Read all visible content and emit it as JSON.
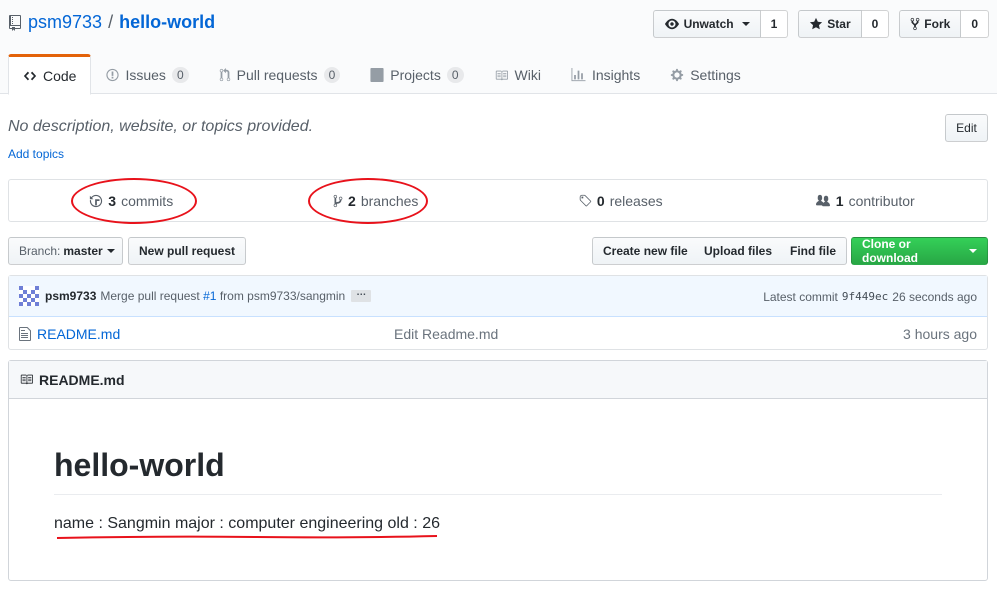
{
  "header": {
    "owner": "psm9733",
    "separator": "/",
    "repo": "hello-world",
    "actions": [
      {
        "label": "Unwatch",
        "count": "1",
        "icon": "eye-icon"
      },
      {
        "label": "Star",
        "count": "0",
        "icon": "star-icon"
      },
      {
        "label": "Fork",
        "count": "0",
        "icon": "fork-icon"
      }
    ]
  },
  "tabs": [
    {
      "label": "Code",
      "icon": "code-icon",
      "counter": null,
      "selected": true
    },
    {
      "label": "Issues",
      "icon": "issue-icon",
      "counter": "0"
    },
    {
      "label": "Pull requests",
      "icon": "pull-request-icon",
      "counter": "0"
    },
    {
      "label": "Projects",
      "icon": "project-icon",
      "counter": "0"
    },
    {
      "label": "Wiki",
      "icon": "book-icon",
      "counter": null
    },
    {
      "label": "Insights",
      "icon": "graph-icon",
      "counter": null
    },
    {
      "label": "Settings",
      "icon": "gear-icon",
      "counter": null
    }
  ],
  "description": {
    "text": "No description, website, or topics provided.",
    "add_topics": "Add topics",
    "edit": "Edit"
  },
  "summary": [
    {
      "count": "3",
      "label": "commits",
      "icon": "history-icon"
    },
    {
      "count": "2",
      "label": "branches",
      "icon": "branch-icon"
    },
    {
      "count": "0",
      "label": "releases",
      "icon": "tag-icon"
    },
    {
      "count": "1",
      "label": "contributor",
      "icon": "people-icon"
    }
  ],
  "filenav": {
    "branch_prefix": "Branch:",
    "branch": "master",
    "new_pr": "New pull request",
    "create_file": "Create new file",
    "upload_files": "Upload files",
    "find_file": "Find file",
    "clone": "Clone or download"
  },
  "commit": {
    "author": "psm9733",
    "message_prefix": "Merge pull request",
    "pr_ref": "#1",
    "message_suffix": "from psm9733/sangmin",
    "ellipsis": "…",
    "latest_label": "Latest commit",
    "sha": "9f449ec",
    "age": "26 seconds ago"
  },
  "files": [
    {
      "name": "README.md",
      "message": "Edit Readme.md",
      "age": "3 hours ago",
      "icon": "file-icon"
    }
  ],
  "readme": {
    "title": "README.md",
    "heading": "hello-world",
    "body": "name : Sangmin major : computer engineering old : 26"
  },
  "colors": {
    "link": "#0366d6",
    "selected_tab_border": "#e36209",
    "clone_button": "#28a745",
    "annotation": "#e8121b"
  }
}
